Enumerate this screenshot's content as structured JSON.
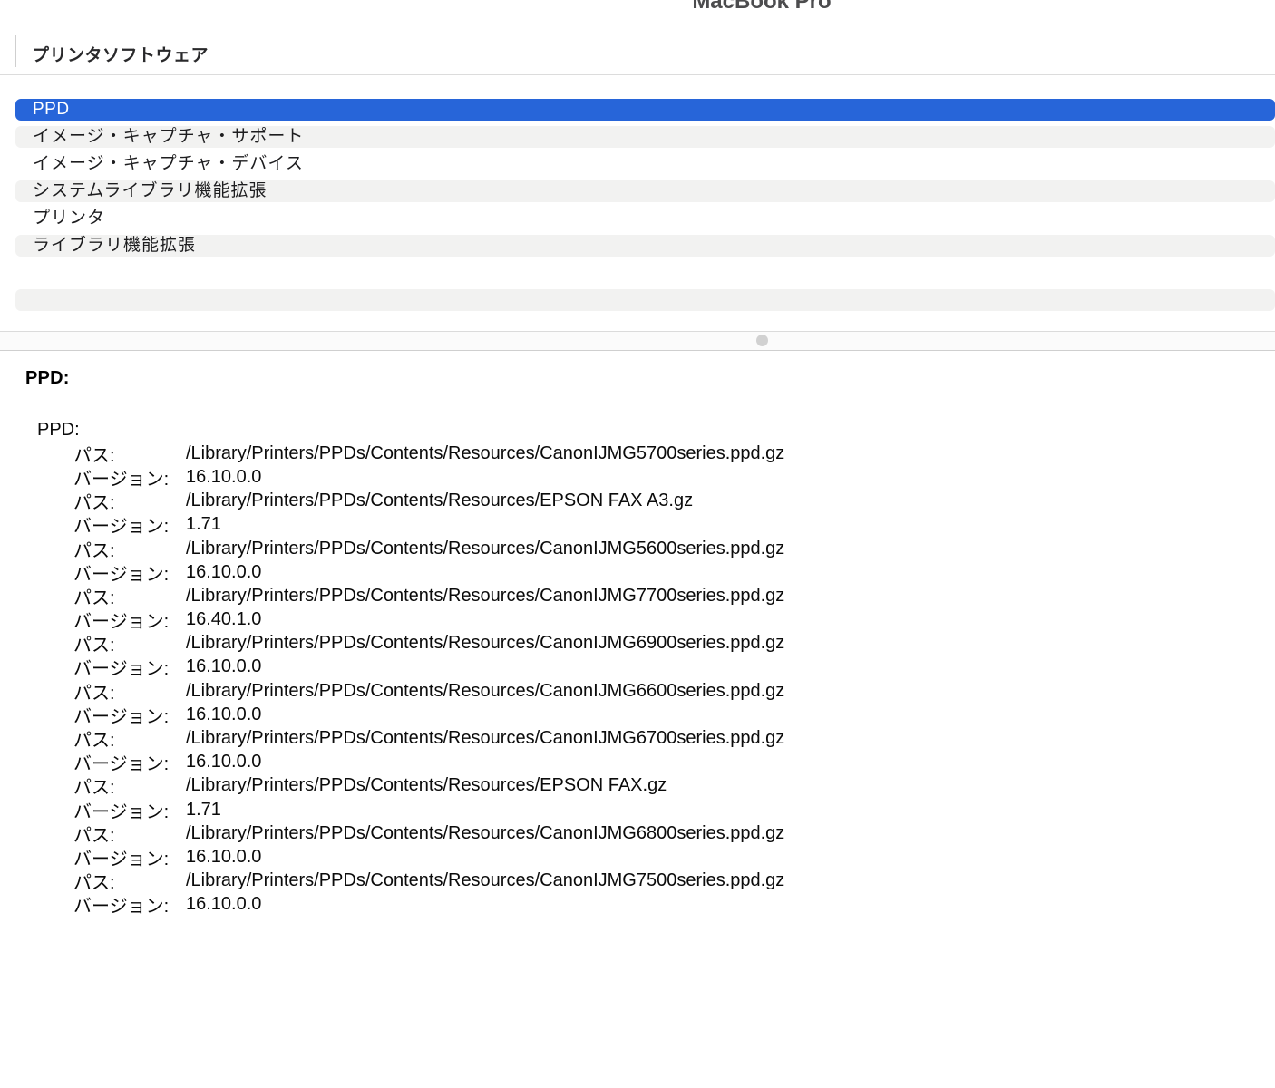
{
  "window": {
    "machine_title": "MacBook Pro"
  },
  "header": {
    "section_title": "プリンタソフトウェア"
  },
  "list": {
    "rows": [
      {
        "label": "PPD",
        "selected": true
      },
      {
        "label": "イメージ・キャプチャ・サポート"
      },
      {
        "label": "イメージ・キャプチャ・デバイス"
      },
      {
        "label": "システムライブラリ機能拡張"
      },
      {
        "label": "プリンタ"
      },
      {
        "label": "ライブラリ機能拡張"
      },
      {
        "label": ""
      },
      {
        "label": ""
      }
    ]
  },
  "detail": {
    "heading": "PPD:",
    "subheading": "PPD:",
    "labels": {
      "path": "パス:",
      "version": "バージョン:"
    },
    "entries": [
      {
        "path": "/Library/Printers/PPDs/Contents/Resources/CanonIJMG5700series.ppd.gz",
        "version": "16.10.0.0"
      },
      {
        "path": "/Library/Printers/PPDs/Contents/Resources/EPSON FAX A3.gz",
        "version": "1.71"
      },
      {
        "path": "/Library/Printers/PPDs/Contents/Resources/CanonIJMG5600series.ppd.gz",
        "version": "16.10.0.0"
      },
      {
        "path": "/Library/Printers/PPDs/Contents/Resources/CanonIJMG7700series.ppd.gz",
        "version": "16.40.1.0"
      },
      {
        "path": "/Library/Printers/PPDs/Contents/Resources/CanonIJMG6900series.ppd.gz",
        "version": "16.10.0.0"
      },
      {
        "path": "/Library/Printers/PPDs/Contents/Resources/CanonIJMG6600series.ppd.gz",
        "version": "16.10.0.0"
      },
      {
        "path": "/Library/Printers/PPDs/Contents/Resources/CanonIJMG6700series.ppd.gz",
        "version": "16.10.0.0"
      },
      {
        "path": "/Library/Printers/PPDs/Contents/Resources/EPSON FAX.gz",
        "version": "1.71"
      },
      {
        "path": "/Library/Printers/PPDs/Contents/Resources/CanonIJMG6800series.ppd.gz",
        "version": "16.10.0.0"
      },
      {
        "path": "/Library/Printers/PPDs/Contents/Resources/CanonIJMG7500series.ppd.gz",
        "version": "16.10.0.0"
      }
    ]
  },
  "ui_colors": {
    "selection_blue": "#2765d9",
    "row_stripe_gray": "#f2f2f1",
    "splitter_dot": "#d1d1d1"
  }
}
